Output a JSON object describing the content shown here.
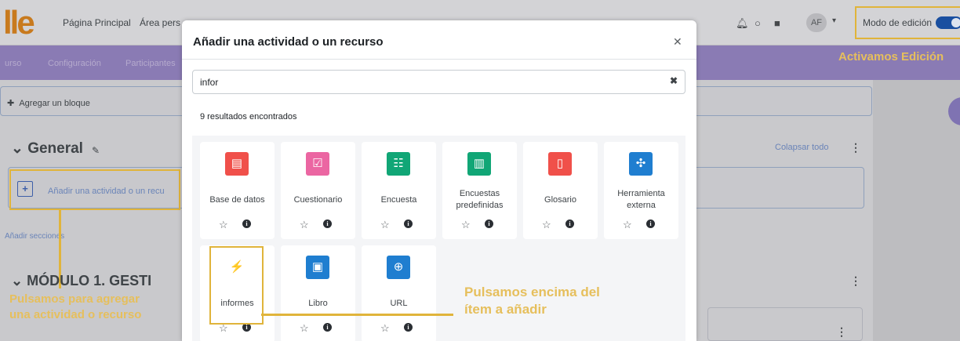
{
  "topbar": {
    "logo": "lle",
    "nav": [
      "Página Principal",
      "Área pers"
    ],
    "avatar": "AF",
    "edit_mode_label": "Modo de edición",
    "hint_edit": "Activamos Edición"
  },
  "tabs": [
    "urso",
    "Configuración",
    "Participantes"
  ],
  "course": {
    "add_block": "Agregar un bloque",
    "general": "General",
    "collapse_all": "Colapsar todo",
    "add_activity": "Añadir una actividad o un recu",
    "add_sections": "Añadir secciones",
    "module": "MÓDULO 1. GESTI"
  },
  "hints": {
    "add": "Pulsamos para agregar una actividad o recurso",
    "item": [
      "Pulsamos encima del",
      "ítem a añadir"
    ]
  },
  "modal": {
    "title": "Añadir una actividad o un recurso",
    "search_value": "infor",
    "results": "9 resultados encontrados",
    "items": [
      {
        "label": "Base de datos",
        "icon": "database-icon",
        "glyph": "▤",
        "color": "#f0504a"
      },
      {
        "label": "Cuestionario",
        "icon": "quiz-icon",
        "glyph": "☑",
        "color": "#eb66a2"
      },
      {
        "label": "Encuesta",
        "icon": "survey-icon",
        "glyph": "☷",
        "color": "#11a676"
      },
      {
        "label": "Encuestas predefinidas",
        "icon": "chart-icon",
        "glyph": "▥",
        "color": "#11a676"
      },
      {
        "label": "Glosario",
        "icon": "glossary-icon",
        "glyph": "▯",
        "color": "#f0504a"
      },
      {
        "label": "Herramienta externa",
        "icon": "puzzle-icon",
        "glyph": "✣",
        "color": "#1f7ed0"
      },
      {
        "label": "informes",
        "icon": "plug-icon",
        "glyph": "⚡",
        "color": "#ffffff"
      },
      {
        "label": "Libro",
        "icon": "book-icon",
        "glyph": "▣",
        "color": "#1f7ed0"
      },
      {
        "label": "URL",
        "icon": "globe-icon",
        "glyph": "⊕",
        "color": "#1f7ed0"
      }
    ]
  }
}
